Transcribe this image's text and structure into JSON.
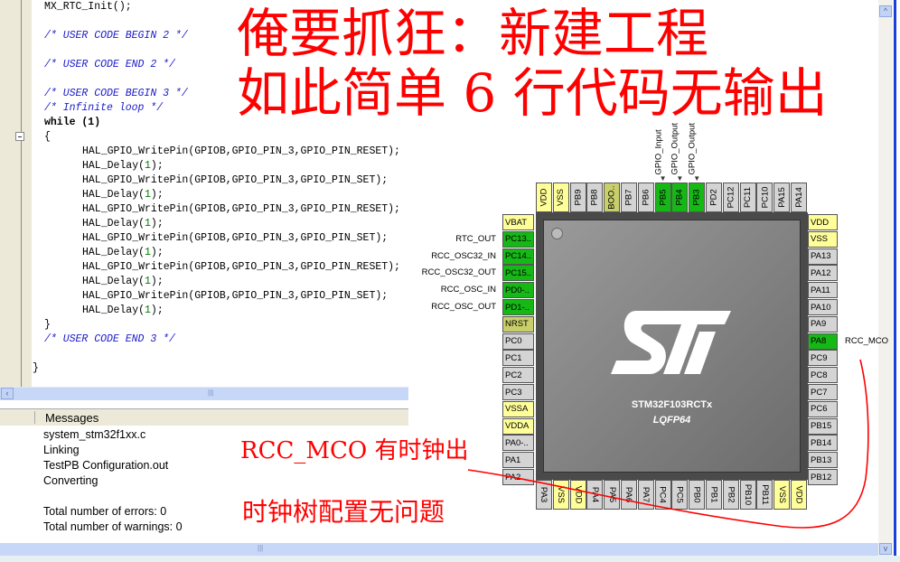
{
  "editor": {
    "lines": [
      {
        "t": "MX_RTC_Init();",
        "c": "n",
        "i": 0
      },
      {
        "t": "/* USER CODE BEGIN 2 */",
        "c": "cm",
        "i": 0
      },
      {
        "t": "/* USER CODE END 2 */",
        "c": "cm",
        "i": 0
      },
      {
        "t": "/* USER CODE BEGIN 3 */",
        "c": "cm",
        "i": 0
      },
      {
        "t": "/* Infinite loop */",
        "c": "cm",
        "i": 0
      },
      {
        "t": "while (1)",
        "c": "kw",
        "i": 0
      },
      {
        "t": "{",
        "c": "n",
        "i": 0
      },
      {
        "t": "HAL_GPIO_WritePin(GPIOB,GPIO_PIN_3,GPIO_PIN_RESET);",
        "c": "n",
        "i": 1
      },
      {
        "t": "HAL_Delay(1);",
        "c": "d",
        "i": 1
      },
      {
        "t": "HAL_GPIO_WritePin(GPIOB,GPIO_PIN_3,GPIO_PIN_SET);",
        "c": "n",
        "i": 1
      },
      {
        "t": "HAL_Delay(1);",
        "c": "d",
        "i": 1
      },
      {
        "t": "HAL_GPIO_WritePin(GPIOB,GPIO_PIN_3,GPIO_PIN_RESET);",
        "c": "n",
        "i": 1
      },
      {
        "t": "HAL_Delay(1);",
        "c": "d",
        "i": 1
      },
      {
        "t": "HAL_GPIO_WritePin(GPIOB,GPIO_PIN_3,GPIO_PIN_SET);",
        "c": "n",
        "i": 1
      },
      {
        "t": "HAL_Delay(1);",
        "c": "d",
        "i": 1
      },
      {
        "t": "HAL_GPIO_WritePin(GPIOB,GPIO_PIN_3,GPIO_PIN_RESET);",
        "c": "n",
        "i": 1
      },
      {
        "t": "HAL_Delay(1);",
        "c": "d",
        "i": 1
      },
      {
        "t": "HAL_GPIO_WritePin(GPIOB,GPIO_PIN_3,GPIO_PIN_SET);",
        "c": "n",
        "i": 1
      },
      {
        "t": "HAL_Delay(1);",
        "c": "d",
        "i": 1
      },
      {
        "t": "}",
        "c": "n",
        "i": 0
      },
      {
        "t": "/* USER CODE END 3 */",
        "c": "cm",
        "i": 0
      },
      {
        "t": "}",
        "c": "n",
        "i": -1
      }
    ]
  },
  "messages": {
    "title": "Messages",
    "lines": [
      "system_stm32f1xx.c",
      "Linking",
      "TestPB Configuration.out",
      "Converting",
      "",
      "Total number of errors: 0",
      "Total number of warnings: 0"
    ]
  },
  "annotations": {
    "title1": "俺要抓狂：新建工程",
    "title2": "如此简单 6 行代码无输出",
    "note1": "RCC_MCO 有时钟出",
    "note2": "时钟树配置无问题",
    "color": "#ff0000"
  },
  "chip": {
    "name": "STM32F103RCTx",
    "package": "LQFP64",
    "logo": "ST",
    "top": [
      [
        "VDD",
        "y"
      ],
      [
        "VSS",
        "y"
      ],
      [
        "PB9",
        "g"
      ],
      [
        "PB8",
        "g"
      ],
      [
        "BOO..",
        "o"
      ],
      [
        "PB7",
        "g"
      ],
      [
        "PB6",
        "g"
      ],
      [
        "PB5",
        "G"
      ],
      [
        "PB4",
        "G"
      ],
      [
        "PB3",
        "G"
      ],
      [
        "PD2",
        "g"
      ],
      [
        "PC12",
        "g"
      ],
      [
        "PC11",
        "g"
      ],
      [
        "PC10",
        "g"
      ],
      [
        "PA15",
        "g"
      ],
      [
        "PA14",
        "g"
      ]
    ],
    "top_labels": {
      "PB5": "GPIO_Input",
      "PB4": "GPIO_Output",
      "PB3": "GPIO_Output"
    },
    "left": [
      [
        "VBAT",
        "y"
      ],
      [
        "PC13..",
        "G"
      ],
      [
        "PC14..",
        "G"
      ],
      [
        "PC15..",
        "G"
      ],
      [
        "PD0-..",
        "G"
      ],
      [
        "PD1-..",
        "G"
      ],
      [
        "NRST",
        "o"
      ],
      [
        "PC0",
        "g"
      ],
      [
        "PC1",
        "g"
      ],
      [
        "PC2",
        "g"
      ],
      [
        "PC3",
        "g"
      ],
      [
        "VSSA",
        "y"
      ],
      [
        "VDDA",
        "y"
      ],
      [
        "PA0-..",
        "g"
      ],
      [
        "PA1",
        "g"
      ],
      [
        "PA2",
        "g"
      ]
    ],
    "left_labels": {
      "PC13..": "RTC_OUT",
      "PC14..": "RCC_OSC32_IN",
      "PC15..": "RCC_OSC32_OUT",
      "PD0-..": "RCC_OSC_IN",
      "PD1-..": "RCC_OSC_OUT"
    },
    "right": [
      [
        "VDD",
        "y"
      ],
      [
        "VSS",
        "y"
      ],
      [
        "PA13",
        "g"
      ],
      [
        "PA12",
        "g"
      ],
      [
        "PA11",
        "g"
      ],
      [
        "PA10",
        "g"
      ],
      [
        "PA9",
        "g"
      ],
      [
        "PA8",
        "G"
      ],
      [
        "PC9",
        "g"
      ],
      [
        "PC8",
        "g"
      ],
      [
        "PC7",
        "g"
      ],
      [
        "PC6",
        "g"
      ],
      [
        "PB15",
        "g"
      ],
      [
        "PB14",
        "g"
      ],
      [
        "PB13",
        "g"
      ],
      [
        "PB12",
        "g"
      ]
    ],
    "right_labels": {
      "PA8": "RCC_MCO"
    },
    "bottom": [
      [
        "PA3",
        "g"
      ],
      [
        "VSS",
        "y"
      ],
      [
        "VDD",
        "y"
      ],
      [
        "PA4",
        "g"
      ],
      [
        "PA5",
        "g"
      ],
      [
        "PA6",
        "g"
      ],
      [
        "PA7",
        "g"
      ],
      [
        "PC4",
        "g"
      ],
      [
        "PC5",
        "g"
      ],
      [
        "PB0",
        "g"
      ],
      [
        "PB1",
        "g"
      ],
      [
        "PB2",
        "g"
      ],
      [
        "PB10",
        "g"
      ],
      [
        "PB11",
        "g"
      ],
      [
        "VSS",
        "y"
      ],
      [
        "VDD",
        "y"
      ]
    ],
    "colors": {
      "g": "#d4d4d4",
      "y": "#ffff99",
      "G": "#16b816",
      "o": "#c8cf6a"
    }
  },
  "icons": {
    "fold": "collapse-minus-icon",
    "pin": "pushpin-icon",
    "left": "scroll-left-icon",
    "up": "scroll-up-icon",
    "down": "scroll-down-icon"
  }
}
